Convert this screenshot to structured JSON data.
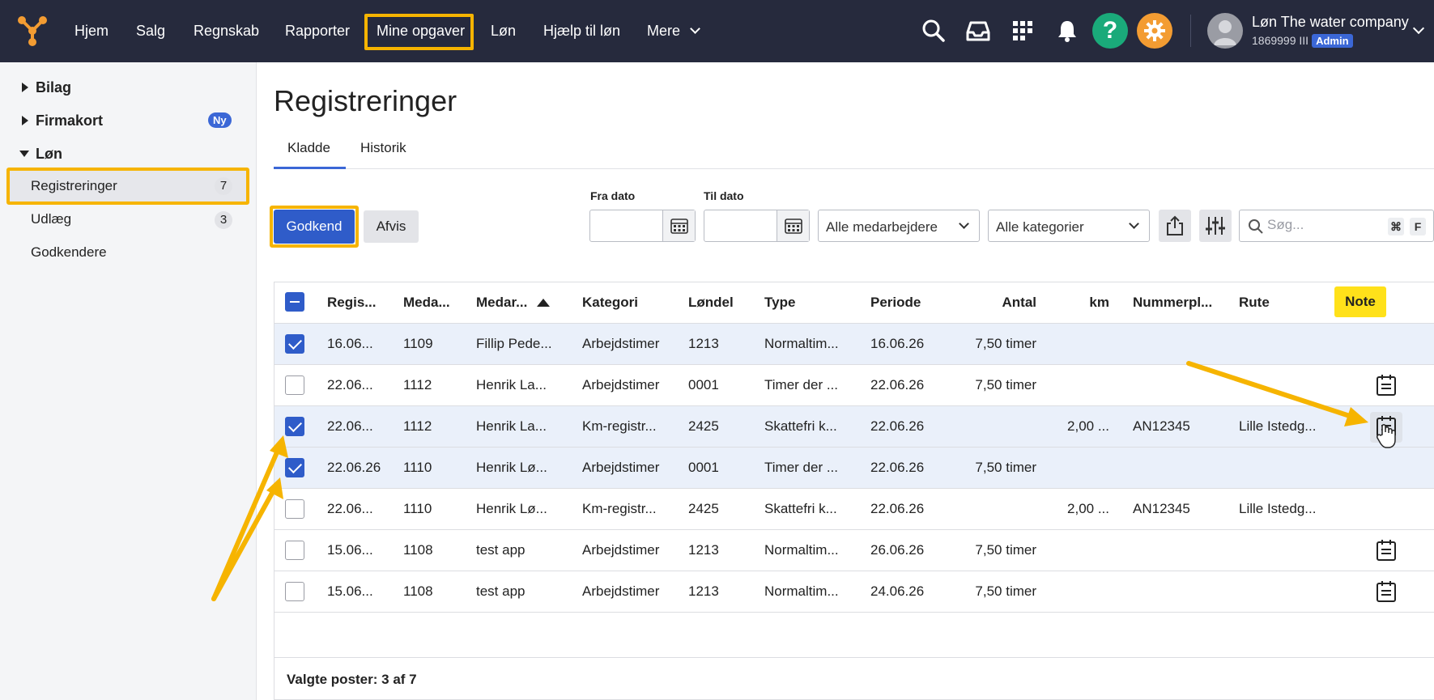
{
  "nav": {
    "items": [
      "Hjem",
      "Salg",
      "Regnskab",
      "Rapporter",
      "Mine opgaver",
      "Løn",
      "Hjælp til løn",
      "Mere"
    ],
    "help_symbol": "?",
    "icons": [
      "search-icon",
      "inbox-icon",
      "apps-grid-icon",
      "bell-icon",
      "help-icon",
      "gear-icon"
    ],
    "colors": {
      "bar": "#262a3d",
      "help": "#1aaa7a",
      "settings": "#f39c32",
      "highlight": "#f6b400"
    }
  },
  "user": {
    "company": "Løn The water company",
    "account": "1869999 III",
    "role": "Admin"
  },
  "sidebar": {
    "groups": [
      {
        "label": "Bilag",
        "expanded": false
      },
      {
        "label": "Firmakort",
        "expanded": false,
        "badge": "Ny"
      },
      {
        "label": "Løn",
        "expanded": true
      }
    ],
    "items": [
      {
        "label": "Registreringer",
        "count": "7",
        "active": true
      },
      {
        "label": "Udlæg",
        "count": "3"
      },
      {
        "label": "Godkendere"
      }
    ]
  },
  "main": {
    "title": "Registreringer",
    "tabs": [
      {
        "label": "Kladde",
        "active": true
      },
      {
        "label": "Historik"
      }
    ]
  },
  "toolbar": {
    "approve": "Godkend",
    "reject": "Afvis",
    "from_label": "Fra dato",
    "to_label": "Til dato",
    "employees_select": "Alle medarbejdere",
    "categories_select": "Alle kategorier",
    "search_placeholder": "Søg...",
    "shortcut_cmd": "⌘",
    "shortcut_key": "F"
  },
  "table": {
    "headers": [
      "Regis...",
      "Meda...",
      "Medar...",
      "Kategori",
      "Løndel",
      "Type",
      "Periode",
      "Antal",
      "km",
      "Nummerpl...",
      "Rute",
      "Note"
    ],
    "sort_column": "Medar...",
    "rows": [
      {
        "checked": true,
        "date": "16.06...",
        "emp_no": "1109",
        "name": "Fillip Pede...",
        "category": "Arbejdstimer",
        "part": "1213",
        "type": "Normaltim...",
        "period": "16.06.26",
        "amount": "7,50 timer",
        "km": "",
        "plate": "",
        "route": "",
        "note": false
      },
      {
        "checked": false,
        "date": "22.06...",
        "emp_no": "1112",
        "name": "Henrik La...",
        "category": "Arbejdstimer",
        "part": "0001",
        "type": "Timer der ...",
        "period": "22.06.26",
        "amount": "7,50 timer",
        "km": "",
        "plate": "",
        "route": "",
        "note": true
      },
      {
        "checked": true,
        "date": "22.06...",
        "emp_no": "1112",
        "name": "Henrik La...",
        "category": "Km-registr...",
        "part": "2425",
        "type": "Skattefri k...",
        "period": "22.06.26",
        "amount": "",
        "km": "2,00 ...",
        "plate": "AN12345",
        "route": "Lille Istedg...",
        "note": true
      },
      {
        "checked": true,
        "date": "22.06.26",
        "emp_no": "1110",
        "name": "Henrik Lø...",
        "category": "Arbejdstimer",
        "part": "0001",
        "type": "Timer der ...",
        "period": "22.06.26",
        "amount": "7,50 timer",
        "km": "",
        "plate": "",
        "route": "",
        "note": false
      },
      {
        "checked": false,
        "date": "22.06...",
        "emp_no": "1110",
        "name": "Henrik Lø...",
        "category": "Km-registr...",
        "part": "2425",
        "type": "Skattefri k...",
        "period": "22.06.26",
        "amount": "",
        "km": "2,00 ...",
        "plate": "AN12345",
        "route": "Lille Istedg...",
        "note": false
      },
      {
        "checked": false,
        "date": "15.06...",
        "emp_no": "1108",
        "name": "test app",
        "category": "Arbejdstimer",
        "part": "1213",
        "type": "Normaltim...",
        "period": "26.06.26",
        "amount": "7,50 timer",
        "km": "",
        "plate": "",
        "route": "",
        "note": true
      },
      {
        "checked": false,
        "date": "15.06...",
        "emp_no": "1108",
        "name": "test app",
        "category": "Arbejdstimer",
        "part": "1213",
        "type": "Normaltim...",
        "period": "24.06.26",
        "amount": "7,50 timer",
        "km": "",
        "plate": "",
        "route": "",
        "note": true
      }
    ],
    "footer": "Valgte poster: 3 af 7"
  }
}
